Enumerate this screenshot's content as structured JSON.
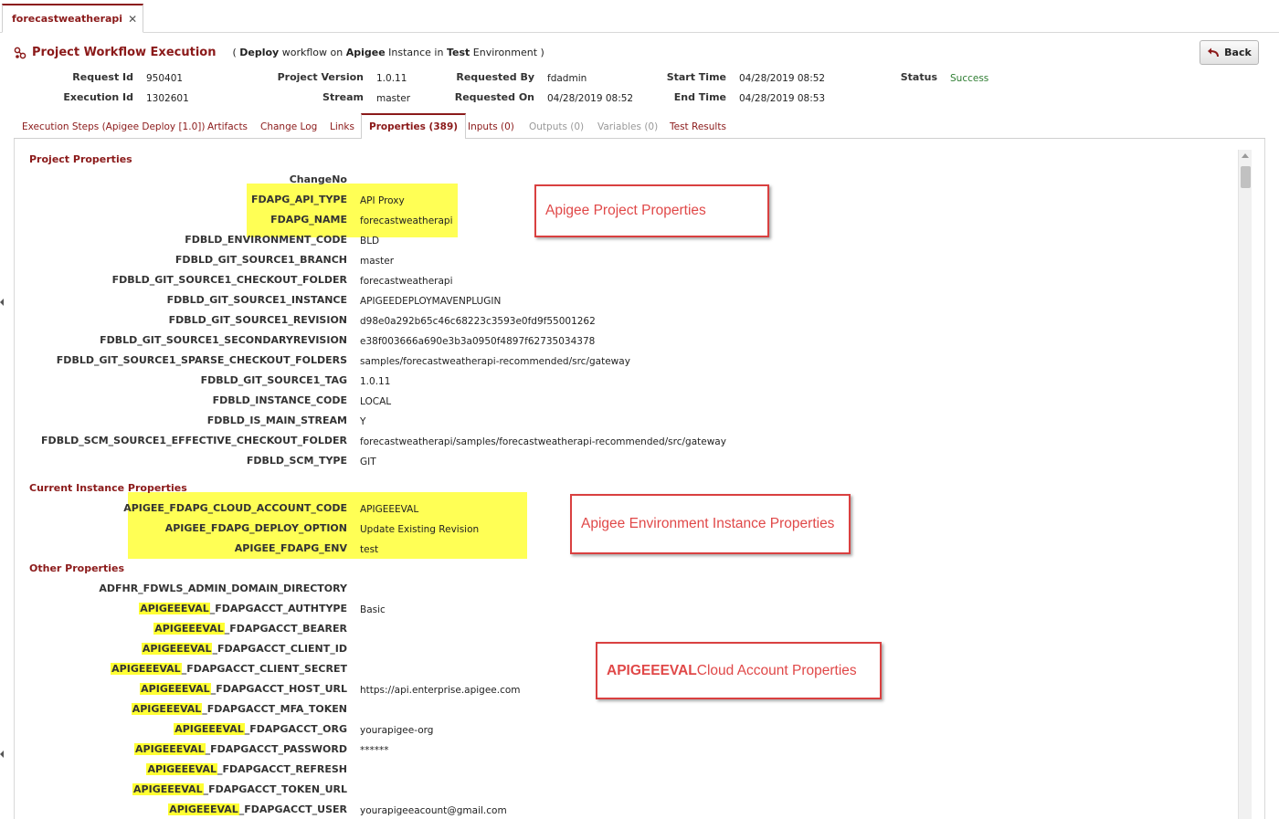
{
  "doc_tab": {
    "label": "forecastweatherapi",
    "close": "✕"
  },
  "header": {
    "title": "Project Workflow Execution",
    "subtitle_open": "( ",
    "subtitle_w1": "Deploy",
    "subtitle_t1": " workflow on ",
    "subtitle_w2": "Apigee",
    "subtitle_t2": " Instance in ",
    "subtitle_w3": "Test",
    "subtitle_t3": " Environment )",
    "back_label": "Back"
  },
  "meta": {
    "request_id_label": "Request Id",
    "request_id": "950401",
    "execution_id_label": "Execution Id",
    "execution_id": "1302601",
    "project_version_label": "Project Version",
    "project_version": "1.0.11",
    "stream_label": "Stream",
    "stream": "master",
    "requested_by_label": "Requested By",
    "requested_by": "fdadmin",
    "requested_on_label": "Requested On",
    "requested_on": "04/28/2019 08:52",
    "start_time_label": "Start Time",
    "start_time": "04/28/2019 08:52",
    "end_time_label": "End Time",
    "end_time": "04/28/2019 08:53",
    "status_label": "Status",
    "status": "Success"
  },
  "tabs": [
    {
      "label": "Execution Steps (Apigee Deploy [1.0])",
      "state": "normal"
    },
    {
      "label": "Artifacts",
      "state": "normal"
    },
    {
      "label": "Change Log",
      "state": "normal"
    },
    {
      "label": "Links",
      "state": "normal"
    },
    {
      "label": "Properties (389)",
      "state": "active"
    },
    {
      "label": "Inputs (0)",
      "state": "normal"
    },
    {
      "label": "Outputs (0)",
      "state": "disabled"
    },
    {
      "label": "Variables (0)",
      "state": "disabled"
    },
    {
      "label": "Test Results",
      "state": "normal"
    }
  ],
  "sections": {
    "project": "Project Properties",
    "instance": "Current Instance Properties",
    "other": "Other Properties"
  },
  "project_props": [
    {
      "key": "ChangeNo",
      "value": ""
    },
    {
      "key": "FDAPG_API_TYPE",
      "value": "API Proxy"
    },
    {
      "key": "FDAPG_NAME",
      "value": "forecastweatherapi"
    },
    {
      "key": "FDBLD_ENVIRONMENT_CODE",
      "value": "BLD"
    },
    {
      "key": "FDBLD_GIT_SOURCE1_BRANCH",
      "value": "master"
    },
    {
      "key": "FDBLD_GIT_SOURCE1_CHECKOUT_FOLDER",
      "value": "forecastweatherapi"
    },
    {
      "key": "FDBLD_GIT_SOURCE1_INSTANCE",
      "value": "APIGEEDEPLOYMAVENPLUGIN"
    },
    {
      "key": "FDBLD_GIT_SOURCE1_REVISION",
      "value": "d98e0a292b65c46c68223c3593e0fd9f55001262"
    },
    {
      "key": "FDBLD_GIT_SOURCE1_SECONDARYREVISION",
      "value": "e38f003666a690e3b3a0950f4897f62735034378"
    },
    {
      "key": "FDBLD_GIT_SOURCE1_SPARSE_CHECKOUT_FOLDERS",
      "value": "samples/forecastweatherapi-recommended/src/gateway"
    },
    {
      "key": "FDBLD_GIT_SOURCE1_TAG",
      "value": "1.0.11"
    },
    {
      "key": "FDBLD_INSTANCE_CODE",
      "value": "LOCAL"
    },
    {
      "key": "FDBLD_IS_MAIN_STREAM",
      "value": "Y"
    },
    {
      "key": "FDBLD_SCM_SOURCE1_EFFECTIVE_CHECKOUT_FOLDER",
      "value": "forecastweatherapi/samples/forecastweatherapi-recommended/src/gateway"
    },
    {
      "key": "FDBLD_SCM_TYPE",
      "value": "GIT"
    }
  ],
  "instance_props": [
    {
      "key": "APIGEE_FDAPG_CLOUD_ACCOUNT_CODE",
      "value": "APIGEEEVAL"
    },
    {
      "key": "APIGEE_FDAPG_DEPLOY_OPTION",
      "value": "Update Existing Revision"
    },
    {
      "key": "APIGEE_FDAPG_ENV",
      "value": "test"
    }
  ],
  "other_props": [
    {
      "prefix": "",
      "key": "ADFHR_FDWLS_ADMIN_DOMAIN_DIRECTORY",
      "value": ""
    },
    {
      "prefix": "APIGEEEVAL",
      "key": "_FDAPGACCT_AUTHTYPE",
      "value": "Basic"
    },
    {
      "prefix": "APIGEEEVAL",
      "key": "_FDAPGACCT_BEARER",
      "value": ""
    },
    {
      "prefix": "APIGEEEVAL",
      "key": "_FDAPGACCT_CLIENT_ID",
      "value": ""
    },
    {
      "prefix": "APIGEEEVAL",
      "key": "_FDAPGACCT_CLIENT_SECRET",
      "value": ""
    },
    {
      "prefix": "APIGEEEVAL",
      "key": "_FDAPGACCT_HOST_URL",
      "value": "https://api.enterprise.apigee.com"
    },
    {
      "prefix": "APIGEEEVAL",
      "key": "_FDAPGACCT_MFA_TOKEN",
      "value": ""
    },
    {
      "prefix": "APIGEEEVAL",
      "key": "_FDAPGACCT_ORG",
      "value": "yourapigee-org"
    },
    {
      "prefix": "APIGEEEVAL",
      "key": "_FDAPGACCT_PASSWORD",
      "value": "******"
    },
    {
      "prefix": "APIGEEEVAL",
      "key": "_FDAPGACCT_REFRESH",
      "value": ""
    },
    {
      "prefix": "APIGEEEVAL",
      "key": "_FDAPGACCT_TOKEN_URL",
      "value": ""
    },
    {
      "prefix": "APIGEEEVAL",
      "key": "_FDAPGACCT_USER",
      "value": "yourapigeeacount@gmail.com"
    }
  ],
  "callouts": {
    "project": "Apigee Project Properties",
    "instance": "Apigee Environment Instance Properties",
    "cloud_bold": "APIGEEEVAL",
    "cloud_rest": " Cloud Account Properties"
  },
  "colors": {
    "accent": "#8b1a1a",
    "highlight": "#ffff55",
    "callout": "#d94040",
    "status_ok": "#2e7d32"
  },
  "icons": {
    "workflow": "workflow-icon",
    "back": "back-arrow-icon",
    "close": "close-icon"
  }
}
